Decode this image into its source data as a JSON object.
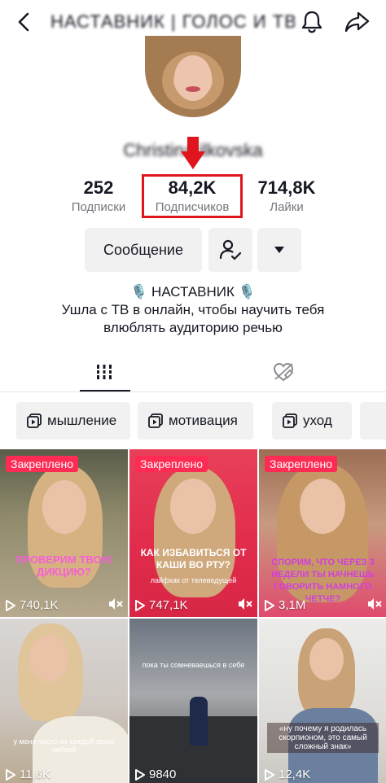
{
  "header": {
    "title": "НАСТАВНИК | ГОЛОС И ТВ"
  },
  "profile": {
    "username": "Christina ilkovska"
  },
  "stats": {
    "following_count": "252",
    "following_label": "Подписки",
    "followers_count": "84,2K",
    "followers_label": "Подписчиков",
    "likes_count": "714,8K",
    "likes_label": "Лайки"
  },
  "actions": {
    "message_label": "Сообщение"
  },
  "bio": {
    "line1": "🎙️ НАСТАВНИК 🎙️",
    "line2": "Ушла с ТВ в онлайн, чтобы научить тебя",
    "line3": "влюблять аудиторию речью"
  },
  "playlists": [
    {
      "label": "мышление"
    },
    {
      "label": "мотивация"
    },
    {
      "label": "уход"
    }
  ],
  "videos": [
    {
      "pinned": "Закреплено",
      "overlay": "ПРОВЕРИМ ТВОЮ ДИКЦИЮ?",
      "caption": "",
      "views": "740,1K"
    },
    {
      "pinned": "Закреплено",
      "overlay": "КАК ИЗБАВИТЬСЯ ОТ КАШИ ВО РТУ?",
      "caption": "лайфхак от телеведущей",
      "views": "747,1K"
    },
    {
      "pinned": "Закреплено",
      "overlay": "СПОРИМ, ЧТО ЧЕРЕЗ 3 НЕДЕЛИ ТЫ НАЧНЕШЬ ГОВОРИТЬ НАМНОГО ЧЕТЧЕ?",
      "caption": "",
      "views": "3,1M"
    },
    {
      "pinned": "",
      "overlay": "",
      "caption": "у меня чисто на каждой фоне нейсей",
      "views": "11,6K"
    },
    {
      "pinned": "",
      "overlay": "",
      "caption": "пока ты сомневаешься в себе",
      "views": "9840"
    },
    {
      "pinned": "",
      "overlay": "",
      "caption": "«ну почему я родилась скорпионом, это самый сложный знак»",
      "views": "12,4K"
    }
  ],
  "colors": {
    "accent": "#fe2c55",
    "highlight_box": "#e0161e",
    "button_bg": "#f1f1f2"
  }
}
